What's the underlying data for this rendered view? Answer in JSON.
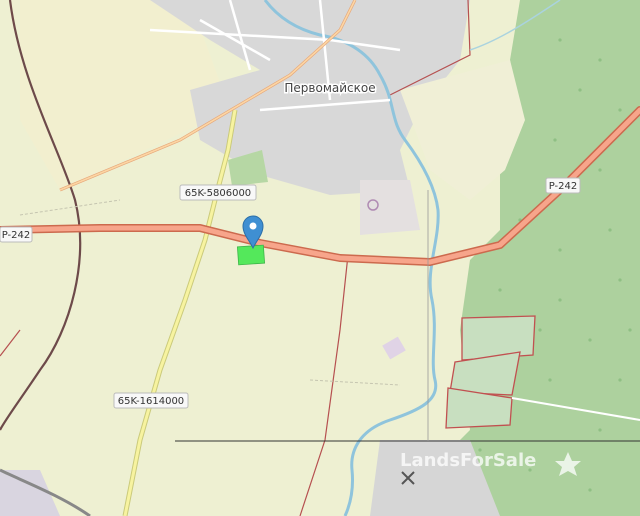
{
  "map": {
    "place_label": "Первомайское",
    "road_labels": {
      "left_highway": "P-242",
      "right_highway": "P-242",
      "north_road": "65K-5806000",
      "south_road": "65K-1614000"
    },
    "watermark": "LandsForSale",
    "colors": {
      "background": "#f1eee2",
      "forest": "#add19e",
      "village": "#d4d4d4",
      "highway": "#f38f6f",
      "highway_casing": "#cc6a4e",
      "river": "#aad3df",
      "secondary_road": "#f7f3a0",
      "marker": "#3f8fd2",
      "parcel": "#54e85b",
      "boundary": "#c15050"
    },
    "icons": {
      "marker": "map-pin-icon",
      "mine": "mine-icon",
      "star": "star-icon"
    }
  }
}
